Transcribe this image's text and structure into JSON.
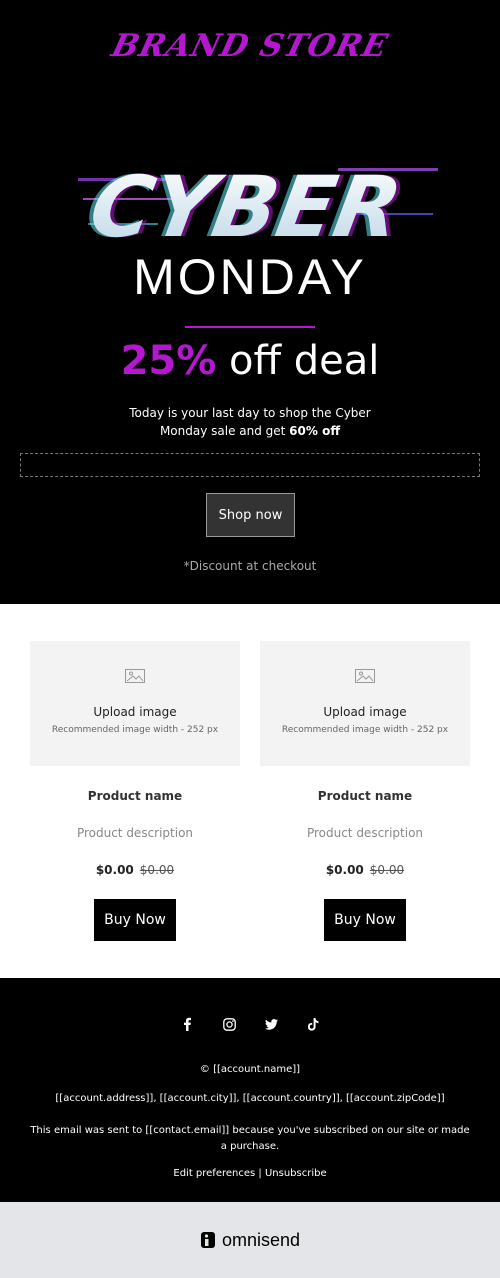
{
  "header": {
    "brand": "BRAND STORE",
    "hero_art_text": "CYBER",
    "hero_subtitle": "MONDAY",
    "deal_percent": "25%",
    "deal_rest": " off deal",
    "sub_text_1": "Today is your last day to shop the Cyber",
    "sub_text_2": "Monday sale and get ",
    "sub_text_bold": "60% off",
    "cta_label": "Shop now",
    "note": "*Discount at checkout"
  },
  "products": [
    {
      "upload_title": "Upload image",
      "upload_hint": "Recommended image width - 252 px",
      "name": "Product name",
      "description": "Product description",
      "price": "$0.00",
      "old_price": "$0.00",
      "buy_label": "Buy Now"
    },
    {
      "upload_title": "Upload image",
      "upload_hint": "Recommended image width - 252 px",
      "name": "Product name",
      "description": "Product description",
      "price": "$0.00",
      "old_price": "$0.00",
      "buy_label": "Buy Now"
    }
  ],
  "footer": {
    "social_icons": [
      "facebook-icon",
      "instagram-icon",
      "twitter-icon",
      "tiktok-icon"
    ],
    "copyright": "© [[account.name]]",
    "address": "[[account.address]], [[account.city]], [[account.country]], [[account.zipCode]]",
    "sent_text": "This email was sent to [[contact.email]] because you've subscribed on our site or made a purchase.",
    "edit_prefs": "Edit preferences",
    "separator": " | ",
    "unsubscribe": "Unsubscribe"
  },
  "powered_by": {
    "logo_text": "omnisend"
  },
  "colors": {
    "accent": "#b517d1",
    "background": "#000000",
    "cyan_glitch": "#5fe6f0"
  }
}
